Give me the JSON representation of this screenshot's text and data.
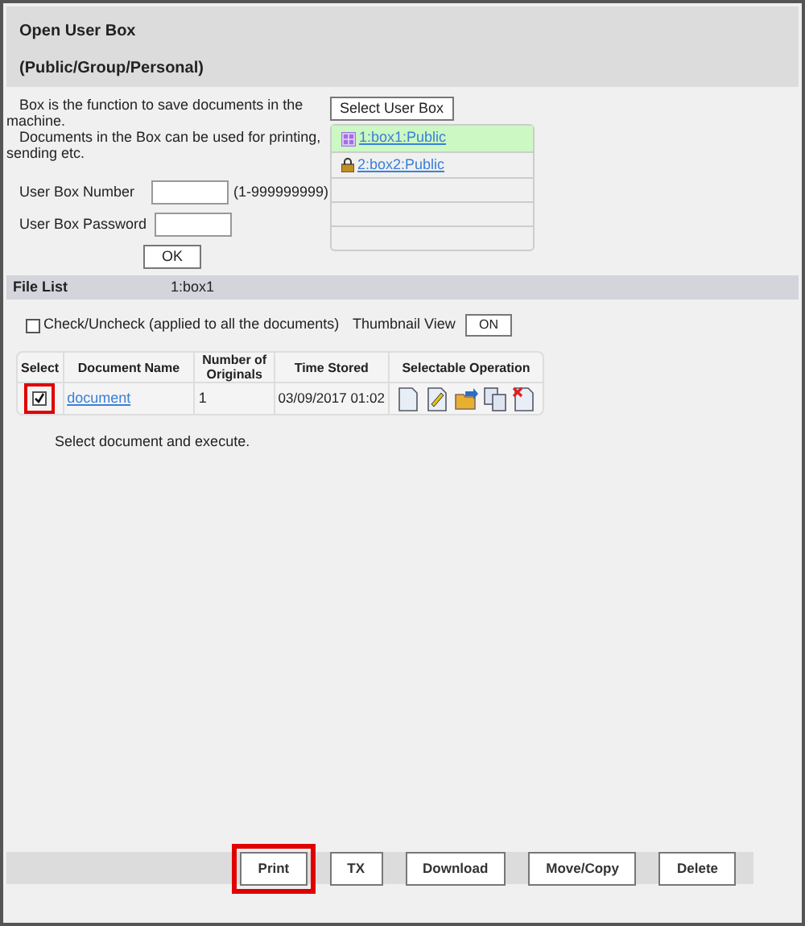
{
  "header": {
    "title": "Open User Box",
    "subtitle": "(Public/Group/Personal)"
  },
  "intro": {
    "line_1": "Box is the function to save documents in the machine.",
    "line_2": "Documents in the Box can be used for printing, sending etc."
  },
  "form": {
    "fields": [
      {
        "label": "User Box Number",
        "hint": "(1-999999999)"
      },
      {
        "label": "User Box Password"
      }
    ],
    "ok_button": "OK"
  },
  "box_list": {
    "button": "Select User Box",
    "items": [
      {
        "label": "1:box1:Public",
        "kind": "public",
        "selected": true
      },
      {
        "label": "2:box2:Public",
        "kind": "locked",
        "selected": false
      }
    ]
  },
  "file_list": {
    "title": "File List",
    "box": "1:box1",
    "check_all": {
      "label": "Check/Uncheck (applied to all the documents)",
      "checked": false
    },
    "thumbnail_label": "Thumbnail View",
    "thumbnail_button": "ON",
    "columns": [
      "Select",
      "Document Name",
      "Number of Originals",
      "Time Stored",
      "Selectable Operation"
    ],
    "rows": [
      {
        "checked": true,
        "highlighted": true,
        "name": "document",
        "originals": "1",
        "time": "03/09/2017 01:02"
      }
    ],
    "message": "Select document and execute."
  },
  "actions": [
    {
      "label": "Print",
      "highlighted": true
    },
    {
      "label": "TX",
      "highlighted": false
    },
    {
      "label": "Download",
      "highlighted": false
    },
    {
      "label": "Move/Copy",
      "highlighted": false
    },
    {
      "label": "Delete",
      "highlighted": false
    }
  ]
}
